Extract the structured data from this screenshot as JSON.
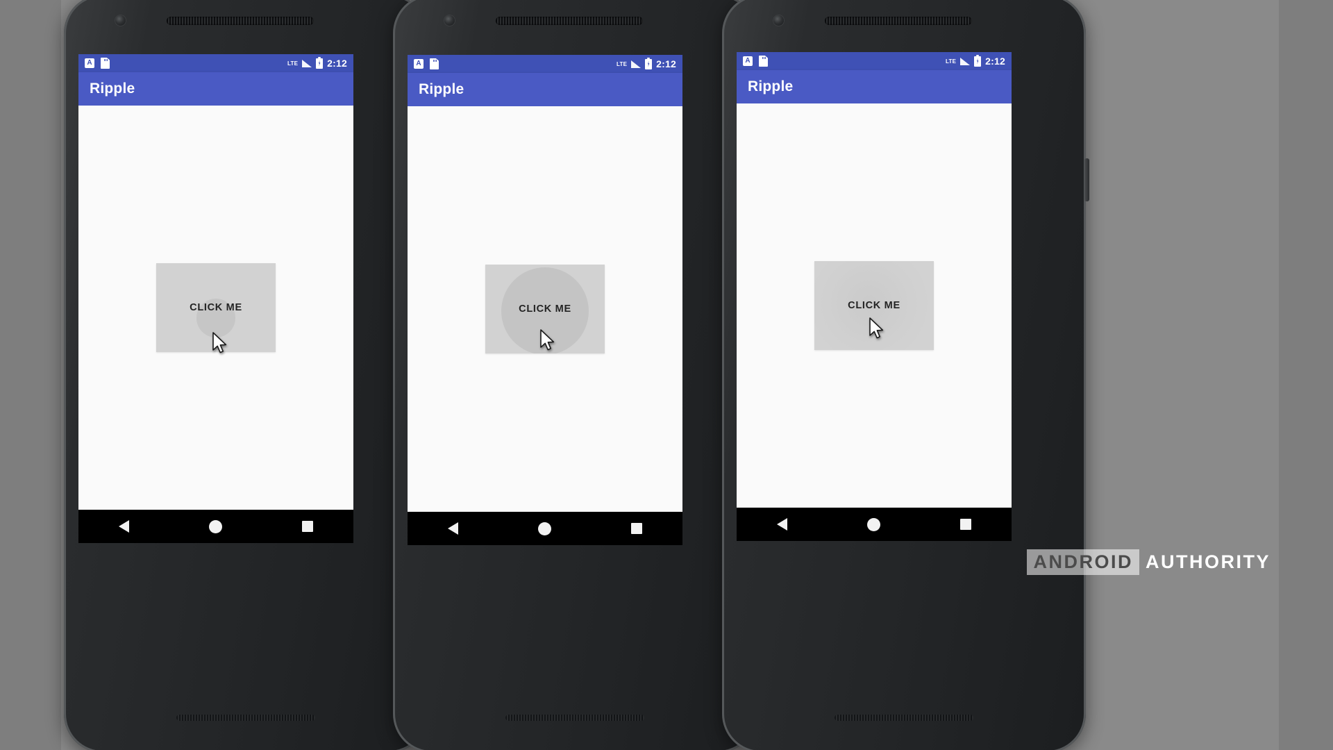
{
  "app": {
    "title": "Ripple",
    "accent_color": "#4a5ac4",
    "statusbar_color": "#3f51b5",
    "button_color": "#d2d2d2",
    "ripple_color": "#c4c4c4",
    "screen_background": "#fafafa",
    "navbar_color": "#000000",
    "page_background": "#8a8a8a"
  },
  "statusbar": {
    "time": "2:12",
    "network_label": "LTE",
    "icons": {
      "app_notification": "A",
      "sd_card": "sd-card-icon",
      "signal": "signal-bars-icon",
      "battery": "battery-charging-icon"
    }
  },
  "button": {
    "label": "CLICK ME"
  },
  "navbar": {
    "back": "back-triangle",
    "home": "home-circle",
    "recents": "recents-square"
  },
  "phones": [
    {
      "id": "phone-1",
      "title": "Ripple",
      "button_label": "CLICK ME",
      "time": "2:12",
      "network_label": "LTE",
      "ripple_state": "ripple-start"
    },
    {
      "id": "phone-2",
      "title": "Ripple",
      "button_label": "CLICK ME",
      "time": "2:12",
      "network_label": "LTE",
      "ripple_state": "ripple-expanded"
    },
    {
      "id": "phone-3",
      "title": "Ripple",
      "button_label": "CLICK ME",
      "time": "2:12",
      "network_label": "LTE",
      "ripple_state": "ripple-faded"
    }
  ],
  "watermark": {
    "part_one": "ANDROID",
    "part_two": "AUTHORITY"
  }
}
